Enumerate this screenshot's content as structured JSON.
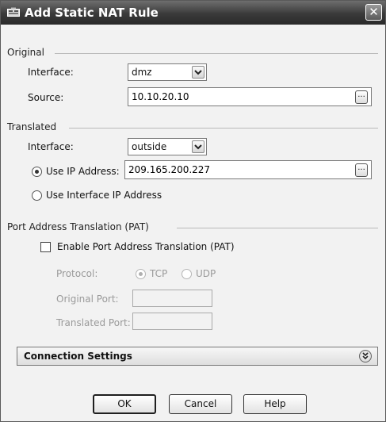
{
  "dialog": {
    "title": "Add Static NAT Rule",
    "close_glyph": "✕"
  },
  "original": {
    "section_title": "Original",
    "interface_label": "Interface:",
    "interface_value": "dmz",
    "source_label": "Source:",
    "source_value": "10.10.20.10",
    "browse_glyph": "..."
  },
  "translated": {
    "section_title": "Translated",
    "interface_label": "Interface:",
    "interface_value": "outside",
    "use_ip_label": "Use IP Address:",
    "use_ip_checked": true,
    "ip_value": "209.165.200.227",
    "browse_glyph": "...",
    "use_interface_ip_label": "Use Interface IP Address",
    "use_interface_ip_checked": false
  },
  "pat": {
    "section_title": "Port Address Translation (PAT)",
    "enable_label": "Enable Port Address Translation (PAT)",
    "enable_checked": false,
    "protocol_label": "Protocol:",
    "tcp_label": "TCP",
    "tcp_checked": true,
    "udp_label": "UDP",
    "udp_checked": false,
    "original_port_label": "Original Port:",
    "original_port_value": "",
    "translated_port_label": "Translated Port:",
    "translated_port_value": ""
  },
  "connection_settings": {
    "label": "Connection Settings"
  },
  "buttons": {
    "ok": "OK",
    "cancel": "Cancel",
    "help": "Help"
  },
  "icons": {
    "title_icon": "nat-rule-icon",
    "dropdown": "chevron-down-icon",
    "expand": "double-chevron-down-icon"
  }
}
